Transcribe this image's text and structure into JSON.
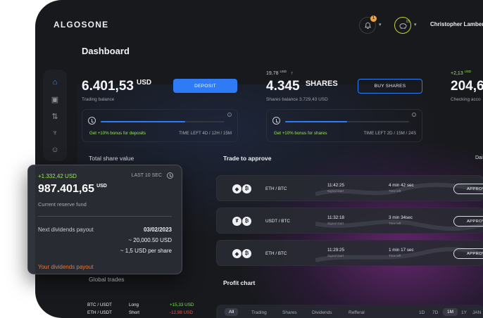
{
  "app": {
    "logo": "ALGOSONE",
    "user_name": "Christopher Lambert",
    "bell_badge": "1",
    "pig_badge": "15",
    "caret": "▾"
  },
  "page": {
    "title": "Dashboard"
  },
  "sidebar": {
    "items": [
      {
        "icon": "home-icon",
        "glyph": "⌂"
      },
      {
        "icon": "wallet-icon",
        "glyph": "▣"
      },
      {
        "icon": "transfer-icon",
        "glyph": "⇅"
      },
      {
        "icon": "trophy-icon",
        "glyph": "♆"
      },
      {
        "icon": "users-icon",
        "glyph": "☺"
      }
    ]
  },
  "trading": {
    "amount": "6.401,53",
    "currency": "USD",
    "label": "Trading balance",
    "deposit_label": "DEPOSIT",
    "bonus_text": "Get +10% bonus for deposits",
    "bonus_time": "TIME LEFT 4D / 12H / 15M",
    "bonus_progress": 0.68
  },
  "shares": {
    "delta": "19,78",
    "delta_currency": "USD",
    "delta_arrow": "↑",
    "amount": "4.345",
    "unit": "SHARES",
    "label": "Shares balance 3.729,43 USD",
    "buy_label": "BUY SHARES",
    "bonus_text": "Get +10% bonus for shares",
    "bonus_time": "TIME LEFT 2D / 15M / 24S",
    "bonus_progress": 0.5
  },
  "checking": {
    "delta": "+2,13",
    "delta_currency": "USD",
    "amount": "204,6",
    "label": "Checking acco"
  },
  "sections": {
    "total_share_value": "Total share value",
    "trade_to_approve": "Trade to approve",
    "trade_right": "Dai",
    "global_trades": "Global trades",
    "profit_chart": "Profit chart"
  },
  "trades": [
    {
      "coin_a": "◆",
      "coin_b": "₿",
      "pair": "ETH / BTC",
      "time": "11:42:25",
      "time_label": "Signal start",
      "left": "4 min 42 sec",
      "left_label": "Time left",
      "action": "APPROV"
    },
    {
      "coin_a": "₮",
      "coin_b": "₿",
      "pair": "USDT / BTC",
      "time": "11:32:18",
      "time_label": "Signal start",
      "left": "3 min 34sec",
      "left_label": "Time left",
      "action": "APPROV"
    },
    {
      "coin_a": "◆",
      "coin_b": "₿",
      "pair": "ETH / BTC",
      "time": "11:29:25",
      "time_label": "Signal start",
      "left": "1 min 17 sec",
      "left_label": "Time left",
      "action": "APPROV"
    }
  ],
  "global_trades": [
    {
      "pair": "BTC / USDT",
      "side": "Long",
      "pnl": "+15,33 USD",
      "color": "#7fe05a"
    },
    {
      "pair": "ETH / USDT",
      "side": "Short",
      "pnl": "-12,98 USD",
      "color": "#f05a4a"
    }
  ],
  "profit_tabs": [
    "All",
    "Trading",
    "Shares",
    "Dividends",
    "Refferal"
  ],
  "range_tabs": [
    "1D",
    "7D",
    "1M",
    "1Y",
    "JAN"
  ],
  "reserve_card": {
    "delta": "+1.332,42 USD",
    "last": "LAST 10 SEC",
    "amount": "987.401,65",
    "currency": "USD",
    "label": "Current reserve fund",
    "payout_label": "Next dividends payout",
    "payout_date": "03/02/2023",
    "payout_usd": "~ 20,000.50 USD",
    "per_share": "~ 1,5 USD per share",
    "link": "Your dividends payout"
  },
  "colors": {
    "accent": "#2f7bf5",
    "positive": "#9ae85a",
    "negative": "#f05a4a",
    "link": "#f2762e",
    "bg": "#18191d"
  }
}
